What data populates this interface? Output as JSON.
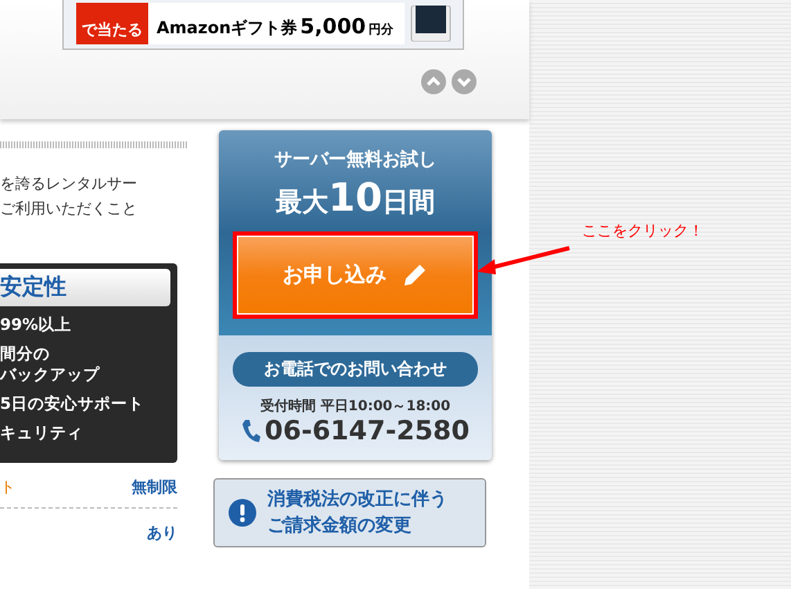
{
  "banner": {
    "badge": "で当たる",
    "gift": "Amazonギフト券",
    "amount": "5,000",
    "unit": "円分"
  },
  "intro": {
    "lines": [
      "を誇るレンタルサー",
      "ご利用いただくこと"
    ]
  },
  "feature_box": {
    "heading": "安定性",
    "items": [
      {
        "lines": [
          "99%以上"
        ]
      },
      {
        "lines": [
          "間分の",
          "バックアップ"
        ]
      },
      {
        "lines": [
          "5日の安心サポート"
        ]
      },
      {
        "lines": [
          "キュリティ"
        ]
      }
    ]
  },
  "spec_rows": [
    {
      "label": "ト",
      "value": "無制限"
    },
    {
      "label": "",
      "value": "あり"
    }
  ],
  "trial": {
    "title": "サーバー無料お試し",
    "prefix": "最大",
    "days": "10",
    "suffix": "日間",
    "button": "お申し込み"
  },
  "contact": {
    "pill": "お電話でのお問い合わせ",
    "hours": "受付時間 平日10:00～18:00",
    "phone": "06-6147-2580"
  },
  "notice": {
    "lines": [
      "消費税法の改正に伴う",
      "ご請求金額の変更"
    ]
  },
  "annotation": {
    "text": "ここをクリック！"
  }
}
